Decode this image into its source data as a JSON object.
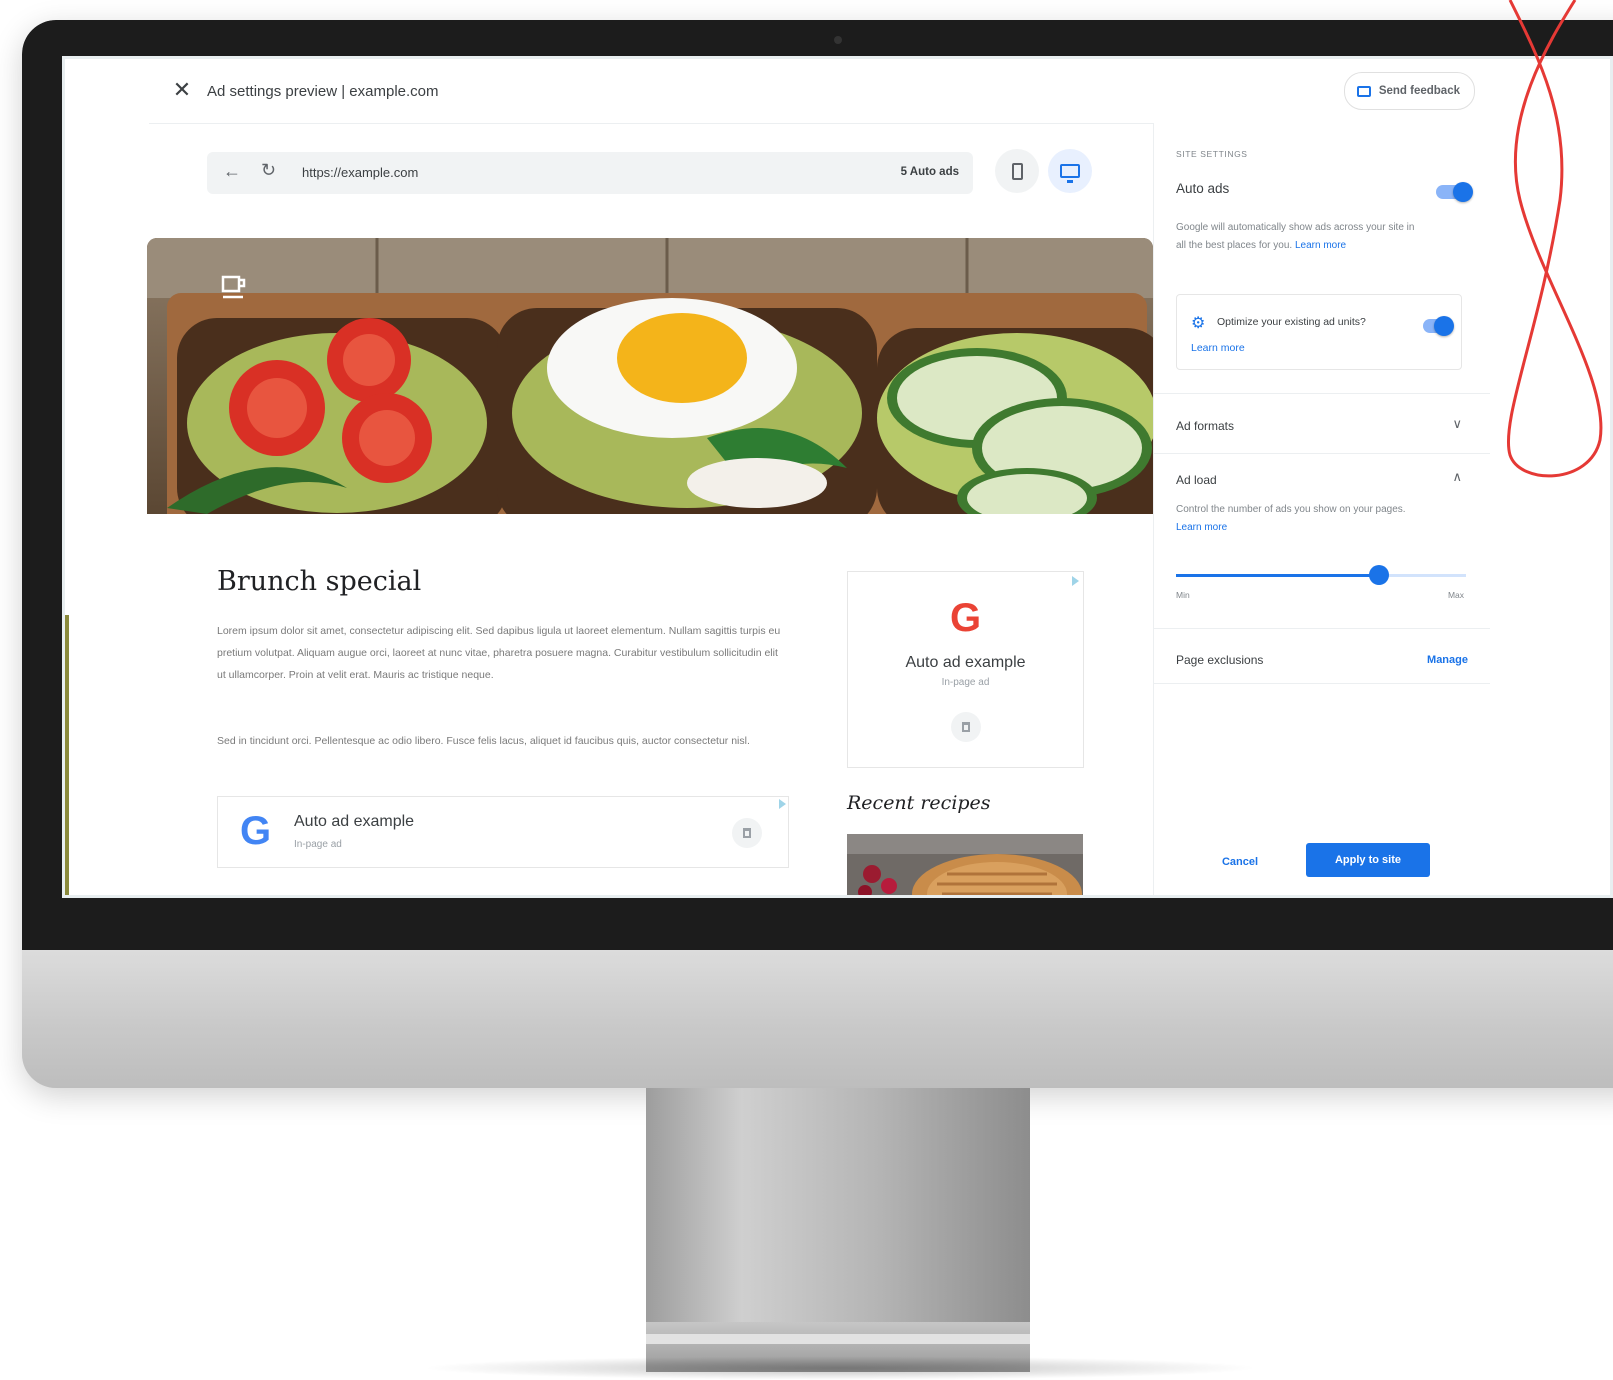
{
  "window": {
    "title": "Ad settings preview | example.com"
  },
  "toolbar": {
    "feedback_label": "Send feedback"
  },
  "browser": {
    "url": "https://example.com",
    "auto_ads_count": "5 Auto ads"
  },
  "article": {
    "title": "Brunch special",
    "paragraph_1": "Lorem ipsum dolor sit amet, consectetur adipiscing elit. Sed dapibus ligula ut laoreet elementum. Nullam sagittis turpis eu pretium volutpat. Aliquam augue orci, laoreet at nunc vitae, pharetra posuere magna. Curabitur vestibulum sollicitudin elit ut ullamcorper. Proin at velit erat. Mauris ac tristique neque.",
    "paragraph_2": "Sed in tincidunt orci. Pellentesque ac odio libero. Fusce felis lacus, aliquet id faucibus quis, auctor consectetur nisl."
  },
  "ads": {
    "inline": {
      "logo": "G",
      "title": "Auto ad example",
      "subtitle": "In-page ad"
    },
    "sidebar": {
      "logo": "G",
      "title": "Auto ad example",
      "subtitle": "In-page ad"
    }
  },
  "sidebar_content": {
    "recent_title": "Recent recipes"
  },
  "settings": {
    "section_label": "SITE SETTINGS",
    "auto_ads": {
      "title": "Auto ads",
      "enabled": true,
      "description": "Google will automatically show ads across your site in all the best places for you.",
      "learn_more": "Learn more"
    },
    "optimize": {
      "label": "Optimize your existing ad units?",
      "enabled": true,
      "learn_more": "Learn more"
    },
    "ad_formats": {
      "title": "Ad formats"
    },
    "ad_load": {
      "title": "Ad load",
      "description": "Control the number of ads you show on your pages.",
      "learn_more": "Learn more",
      "level": 0.7,
      "min_label": "Min",
      "max_label": "Max"
    },
    "page_exclusions": {
      "title": "Page exclusions",
      "manage_label": "Manage"
    },
    "cancel_label": "Cancel",
    "apply_label": "Apply to site"
  },
  "colors": {
    "accent": "#1a73e8",
    "scribble": "#e53935"
  }
}
